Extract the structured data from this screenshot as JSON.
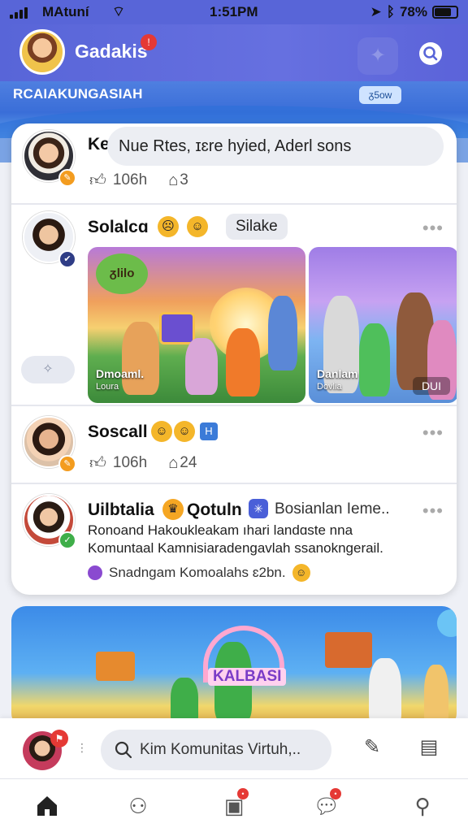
{
  "status": {
    "carrier": "MAtuní",
    "time": "1:51PM",
    "battery": "78%",
    "battery_level": 0.78
  },
  "header": {
    "title": "Gadakis",
    "notification_count": "!"
  },
  "section": {
    "label": "RCAIAKUNGASIAH",
    "chip": "ᵹ5ᴏᴡ"
  },
  "posts": [
    {
      "name": "Ke",
      "bubble": "Nue Rtes, ɪɛre hyied, Aderl sons",
      "likes": "106h",
      "shares": "3"
    },
    {
      "name": "Solalcɑ",
      "tag": "Silake",
      "photos": [
        {
          "caption": "Dmoaml.",
          "sub": "Loura"
        },
        {
          "caption": "Danlam",
          "sub": "Dovlia",
          "video_label": "DUI"
        }
      ]
    },
    {
      "name": "Soscall",
      "likes": "106h",
      "shares": "24"
    },
    {
      "name": "Uilbtalia",
      "name2": "Qotuln",
      "extra": "Bosianlan Ieme..",
      "line1": "Ronoand Hakoukleakam ıhari landɑste nna",
      "line2": "Komuntaal Kamnisiaradengavlah ssanokngerail.",
      "link": "Snadngam Komoalahs ɛ2bn."
    }
  ],
  "compose": {
    "placeholder": "Kim Komunitas Virtuh,.."
  },
  "icons": {
    "header": [
      "profile-avatar",
      "star-icon",
      "search-icon"
    ],
    "bottom": [
      "home-icon",
      "groups-icon",
      "marketplace-icon",
      "chat-icon",
      "profile-icon"
    ]
  },
  "colors": {
    "header": "#5865d8",
    "accent_red": "#e53935",
    "card_bg": "#ffffff"
  }
}
